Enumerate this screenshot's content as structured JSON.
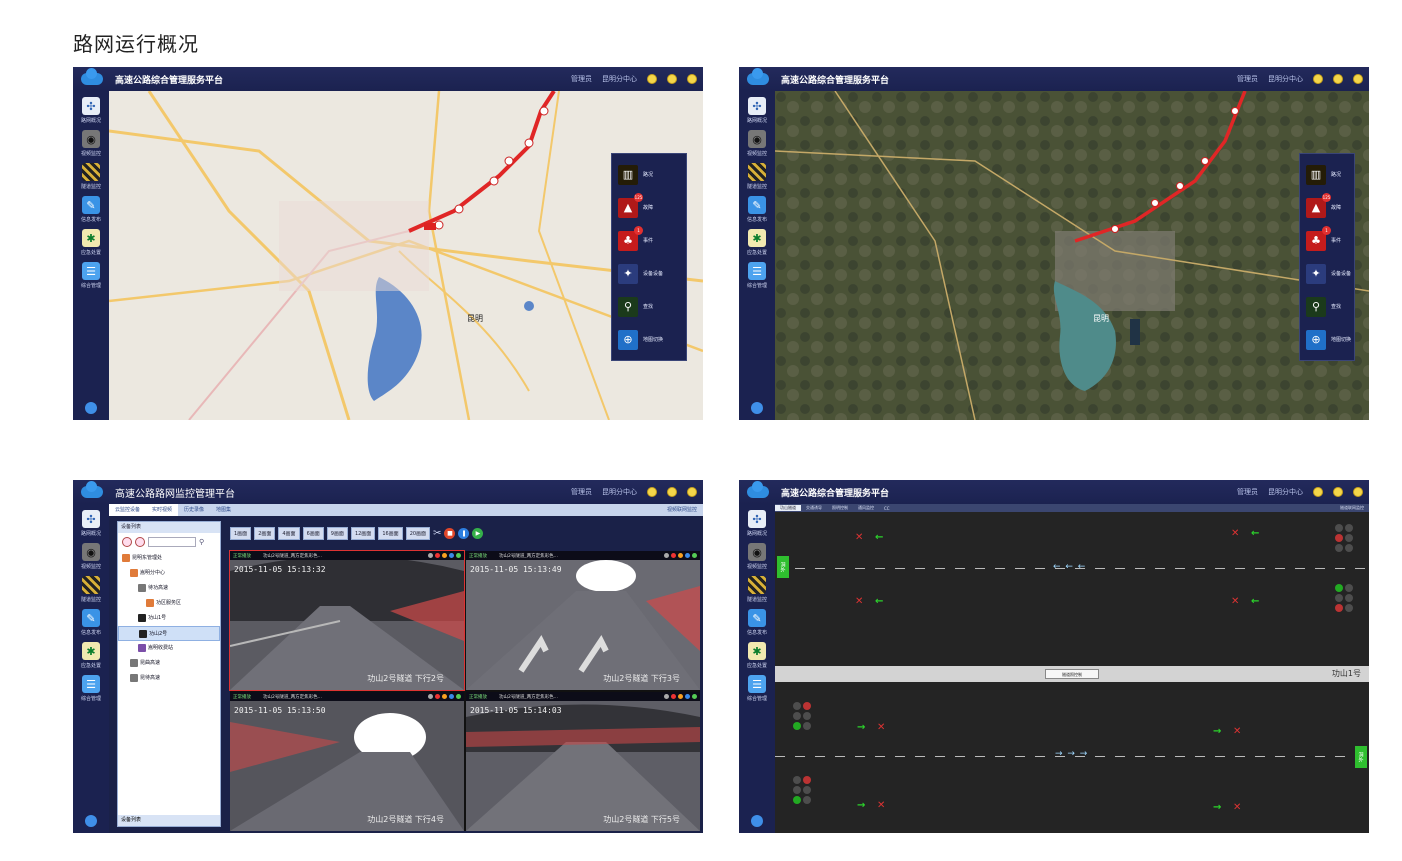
{
  "page_title": "路网运行概况",
  "panels": {
    "map1": {
      "app_title": "高速公路综合管理服务平台",
      "user": "管理员",
      "center": "昆明分中心",
      "city_label": "昆明"
    },
    "map2": {
      "app_title": "高速公路综合管理服务平台",
      "user": "管理员",
      "center": "昆明分中心",
      "city_label": "昆明"
    },
    "monitor": {
      "app_title": "高速公路路网监控管理平台",
      "user": "管理员",
      "center": "昆明分中心",
      "tabs": [
        "云监控设备",
        "实时视频",
        "历史录像",
        "地图集"
      ],
      "tab_right": "视频联网监控",
      "device_list_title": "设备列表",
      "device_list_footer": "设备列表",
      "tree": [
        {
          "label": "昆明东管理处",
          "indent": 0
        },
        {
          "label": "嵩明分中心",
          "indent": 1
        },
        {
          "label": "待功高速",
          "indent": 2
        },
        {
          "label": "功区服务区",
          "indent": 3
        },
        {
          "label": "功山1号",
          "indent": 2
        },
        {
          "label": "功山2号",
          "indent": 2
        },
        {
          "label": "嵩明收费站",
          "indent": 2
        },
        {
          "label": "昆曲高速",
          "indent": 1
        },
        {
          "label": "昆待高速",
          "indent": 1
        }
      ],
      "layout_buttons": [
        "1画面",
        "2画面",
        "4画面",
        "6画面",
        "9画面",
        "12画面",
        "16画面",
        "20画面"
      ],
      "videos": [
        {
          "status": "正常播放",
          "title": "功山2号隧道_两方定焦彩色...",
          "time": "2015-11-05   15:13:32",
          "caption": "功山2号隧道   下行2号"
        },
        {
          "status": "正常播放",
          "title": "功山2号隧道_两方定焦彩色...",
          "time": "2015-11-05   15:13:49",
          "caption": "功山2号隧道   下行3号"
        },
        {
          "status": "正常播放",
          "title": "功山2号隧道_两方定焦彩色...",
          "time": "2015-11-05   15:13:50",
          "caption": "功山2号隧道   下行4号"
        },
        {
          "status": "正常播放",
          "title": "功山2号隧道_两方定焦彩色...",
          "time": "2015-11-05   15:14:03",
          "caption": "功山2号隧道   下行5号"
        }
      ]
    },
    "tunnel": {
      "app_title": "高速公路综合管理服务平台",
      "user": "管理员",
      "center": "昆明分中心",
      "tabs": [
        "功山隧道",
        "交通诱导",
        "照明控制",
        "通风监控",
        "CC"
      ],
      "tab_right": "隧道联网监控",
      "sep_button": "隧道照控制",
      "tunnel_name": "功山1号",
      "left_sign": "洞外",
      "right_sign": "洞外"
    }
  },
  "sidebar": [
    {
      "label": "路网概况",
      "icon": "road-network-icon"
    },
    {
      "label": "视频监控",
      "icon": "camera-icon"
    },
    {
      "label": "隧道监控",
      "icon": "tunnel-icon"
    },
    {
      "label": "信息发布",
      "icon": "info-publish-icon"
    },
    {
      "label": "应急处置",
      "icon": "emergency-icon"
    },
    {
      "label": "综合管理",
      "icon": "management-icon"
    }
  ],
  "map_tools": [
    {
      "label": "路况",
      "icon": "traffic-light-icon",
      "badge": ""
    },
    {
      "label": "故障",
      "icon": "warning-icon",
      "badge": "125"
    },
    {
      "label": "事件",
      "icon": "alarm-bell-icon",
      "badge": "1"
    },
    {
      "label": "设备设备",
      "icon": "pin-icon",
      "badge": ""
    },
    {
      "label": "查找",
      "icon": "search-icon",
      "badge": ""
    },
    {
      "label": "地图切换",
      "icon": "globe-icon",
      "badge": ""
    }
  ],
  "colors": {
    "nav_bg": "#1a2148",
    "route_red": "#e02626",
    "lake": "#5b86c8",
    "tunnel_bg": "#242424"
  }
}
